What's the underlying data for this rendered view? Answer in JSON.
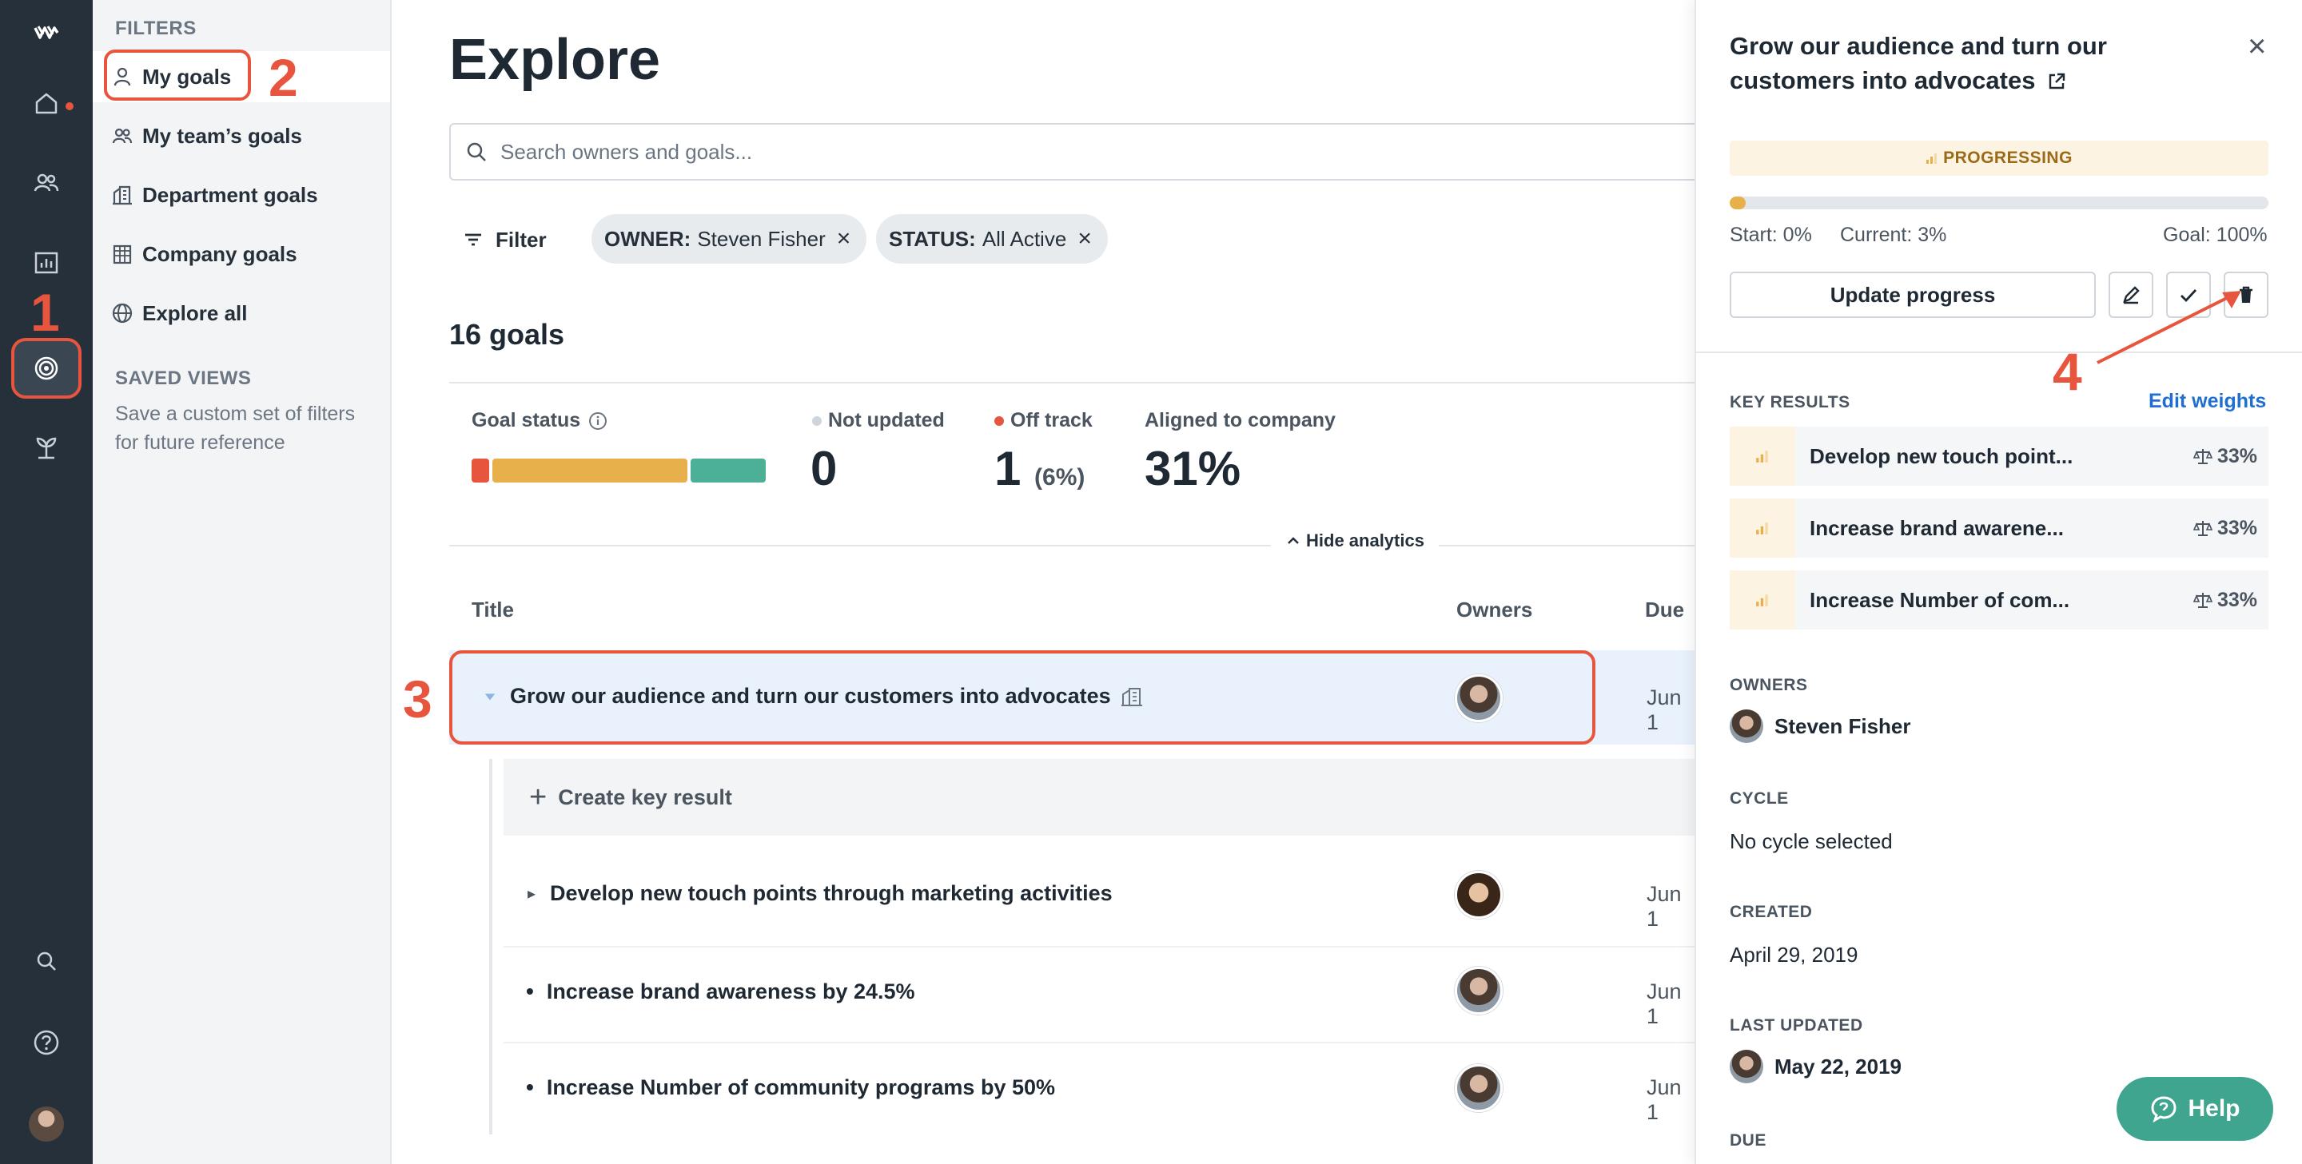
{
  "rail": {
    "items": [
      "logo-icon",
      "home-icon",
      "people-icon",
      "chart-icon",
      "goals-target-icon",
      "growth-icon",
      "search-icon",
      "help-circle-icon"
    ]
  },
  "sidebar": {
    "filters_heading": "FILTERS",
    "items": [
      {
        "label": "My goals",
        "icon": "person-icon",
        "selected": true
      },
      {
        "label": "My team’s goals",
        "icon": "team-icon"
      },
      {
        "label": "Department goals",
        "icon": "building-icon"
      },
      {
        "label": "Company goals",
        "icon": "office-icon"
      },
      {
        "label": "Explore all",
        "icon": "globe-icon"
      }
    ],
    "saved_heading": "SAVED VIEWS",
    "saved_note": "Save a custom set of filters for future reference"
  },
  "annotations": {
    "one": "1",
    "two": "2",
    "three": "3",
    "four": "4",
    "color": "#e8553e"
  },
  "main": {
    "title": "Explore",
    "search_placeholder": "Search owners and goals...",
    "filter_label": "Filter",
    "chips": [
      {
        "key": "OWNER:",
        "value": "Steven Fisher"
      },
      {
        "key": "STATUS:",
        "value": "All Active"
      }
    ],
    "goal_count": "16 goals",
    "analytics": {
      "goal_status_label": "Goal status",
      "status_colors": [
        "#e8553e",
        "#e8b04a",
        "#4bb096"
      ],
      "status_shares": [
        0.06,
        0.68,
        0.26
      ],
      "not_updated_label": "Not updated",
      "not_updated_value": "0",
      "off_track_label": "Off track",
      "off_track_value": "1",
      "off_track_pct": "(6%)",
      "aligned_label": "Aligned to company",
      "aligned_value": "31%",
      "hide_label": "Hide analytics"
    },
    "table": {
      "col_title": "Title",
      "col_owners": "Owners",
      "col_due": "Due",
      "goal_title": "Grow our audience and turn our customers into advocates",
      "goal_due": "Jun 1",
      "create_kr": "Create key result",
      "rows": [
        {
          "title": "Develop new touch points through marketing activities",
          "due": "Jun 1",
          "marker": "▸"
        },
        {
          "title": "Increase brand awareness by 24.5%",
          "due": "Jun 1",
          "marker": "•"
        },
        {
          "title": "Increase Number of community programs by 50%",
          "due": "Jun 1",
          "marker": "•"
        }
      ]
    }
  },
  "panel": {
    "title": "Grow our audience and turn our customers into advocates",
    "status": "PROGRESSING",
    "progress": 0.03,
    "start": "Start: 0%",
    "current": "Current: 3%",
    "goal": "Goal: 100%",
    "update_label": "Update progress",
    "key_results_label": "KEY RESULTS",
    "edit_weights": "Edit weights",
    "key_results": [
      {
        "title": "Develop new touch point...",
        "weight": "33%"
      },
      {
        "title": "Increase brand awarene...",
        "weight": "33%"
      },
      {
        "title": "Increase Number of com...",
        "weight": "33%"
      }
    ],
    "owners_label": "OWNERS",
    "owner": "Steven Fisher",
    "cycle_label": "CYCLE",
    "cycle": "No cycle selected",
    "created_label": "CREATED",
    "created": "April 29, 2019",
    "updated_label": "LAST UPDATED",
    "updated": "May 22, 2019",
    "due_label": "DUE"
  },
  "help_label": "Help"
}
